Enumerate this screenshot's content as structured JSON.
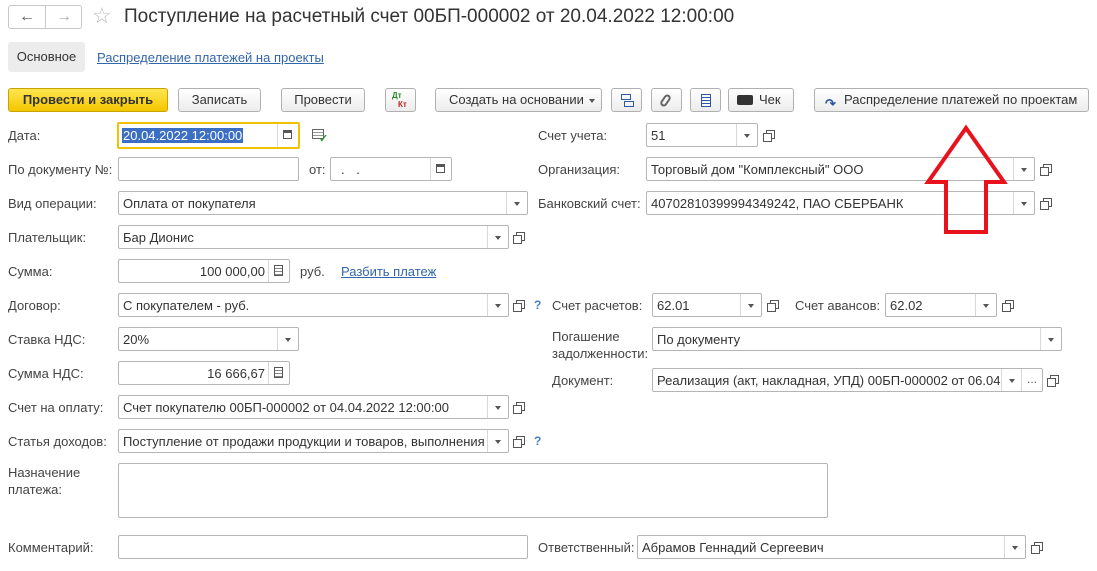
{
  "window": {
    "title": "Поступление на расчетный счет 00БП-000002 от 20.04.2022 12:00:00"
  },
  "tabs": {
    "main": "Основное",
    "projects": "Распределение платежей на проекты"
  },
  "toolbar": {
    "post_close": "Провести и закрыть",
    "save": "Записать",
    "post": "Провести",
    "dtkt_top": "Дт",
    "dtkt_bottom": "Кт",
    "create_based": "Создать на основании",
    "receipt": "Чек",
    "distribute": "Распределение платежей по проектам"
  },
  "form": {
    "date": {
      "label": "Дата:",
      "value": "20.04.2022 12:00:00"
    },
    "doc_no": {
      "label": "По документу №:",
      "value": "",
      "from_label": "от:",
      "from_value": " .  . "
    },
    "op_type": {
      "label": "Вид операции:",
      "value": "Оплата от покупателя"
    },
    "payer": {
      "label": "Плательщик:",
      "value": "Бар Дионис"
    },
    "amount": {
      "label": "Сумма:",
      "value": "100 000,00",
      "currency": "руб.",
      "split_link": "Разбить платеж"
    },
    "contract": {
      "label": "Договор:",
      "value": "С покупателем - руб.",
      "help": "?"
    },
    "vat_rate": {
      "label": "Ставка НДС:",
      "value": "20%"
    },
    "vat_amount": {
      "label": "Сумма НДС:",
      "value": "16 666,67"
    },
    "invoice": {
      "label": "Счет на оплату:",
      "value": "Счет покупателю 00БП-000002 от 04.04.2022 12:00:00"
    },
    "income_item": {
      "label": "Статья доходов:",
      "value": "Поступление от продажи продукции и товаров, выполнения",
      "help": "?"
    },
    "purpose": {
      "label_line1": "Назначение",
      "label_line2": "платежа:",
      "value": ""
    },
    "comment": {
      "label": "Комментарий:",
      "value": ""
    },
    "account": {
      "label": "Счет учета:",
      "value": "51"
    },
    "organization": {
      "label": "Организация:",
      "value": "Торговый дом \"Комплексный\" ООО"
    },
    "bank_account": {
      "label": "Банковский счет:",
      "value": "40702810399994349242, ПАО СБЕРБАНК"
    },
    "settle_account": {
      "label": "Счет расчетов:",
      "value": "62.01"
    },
    "advance_account": {
      "label": "Счет авансов:",
      "value": "62.02"
    },
    "debt_repay": {
      "label_line1": "Погашение",
      "label_line2": "задолженности:",
      "value": "По документу"
    },
    "document": {
      "label": "Документ:",
      "value": "Реализация (акт, накладная, УПД) 00БП-000002 от 06.04",
      "dots": "..."
    },
    "responsible": {
      "label": "Ответственный:",
      "value": "Абрамов Геннадий Сергеевич"
    }
  },
  "annotation": {
    "color": "#e8121c"
  }
}
